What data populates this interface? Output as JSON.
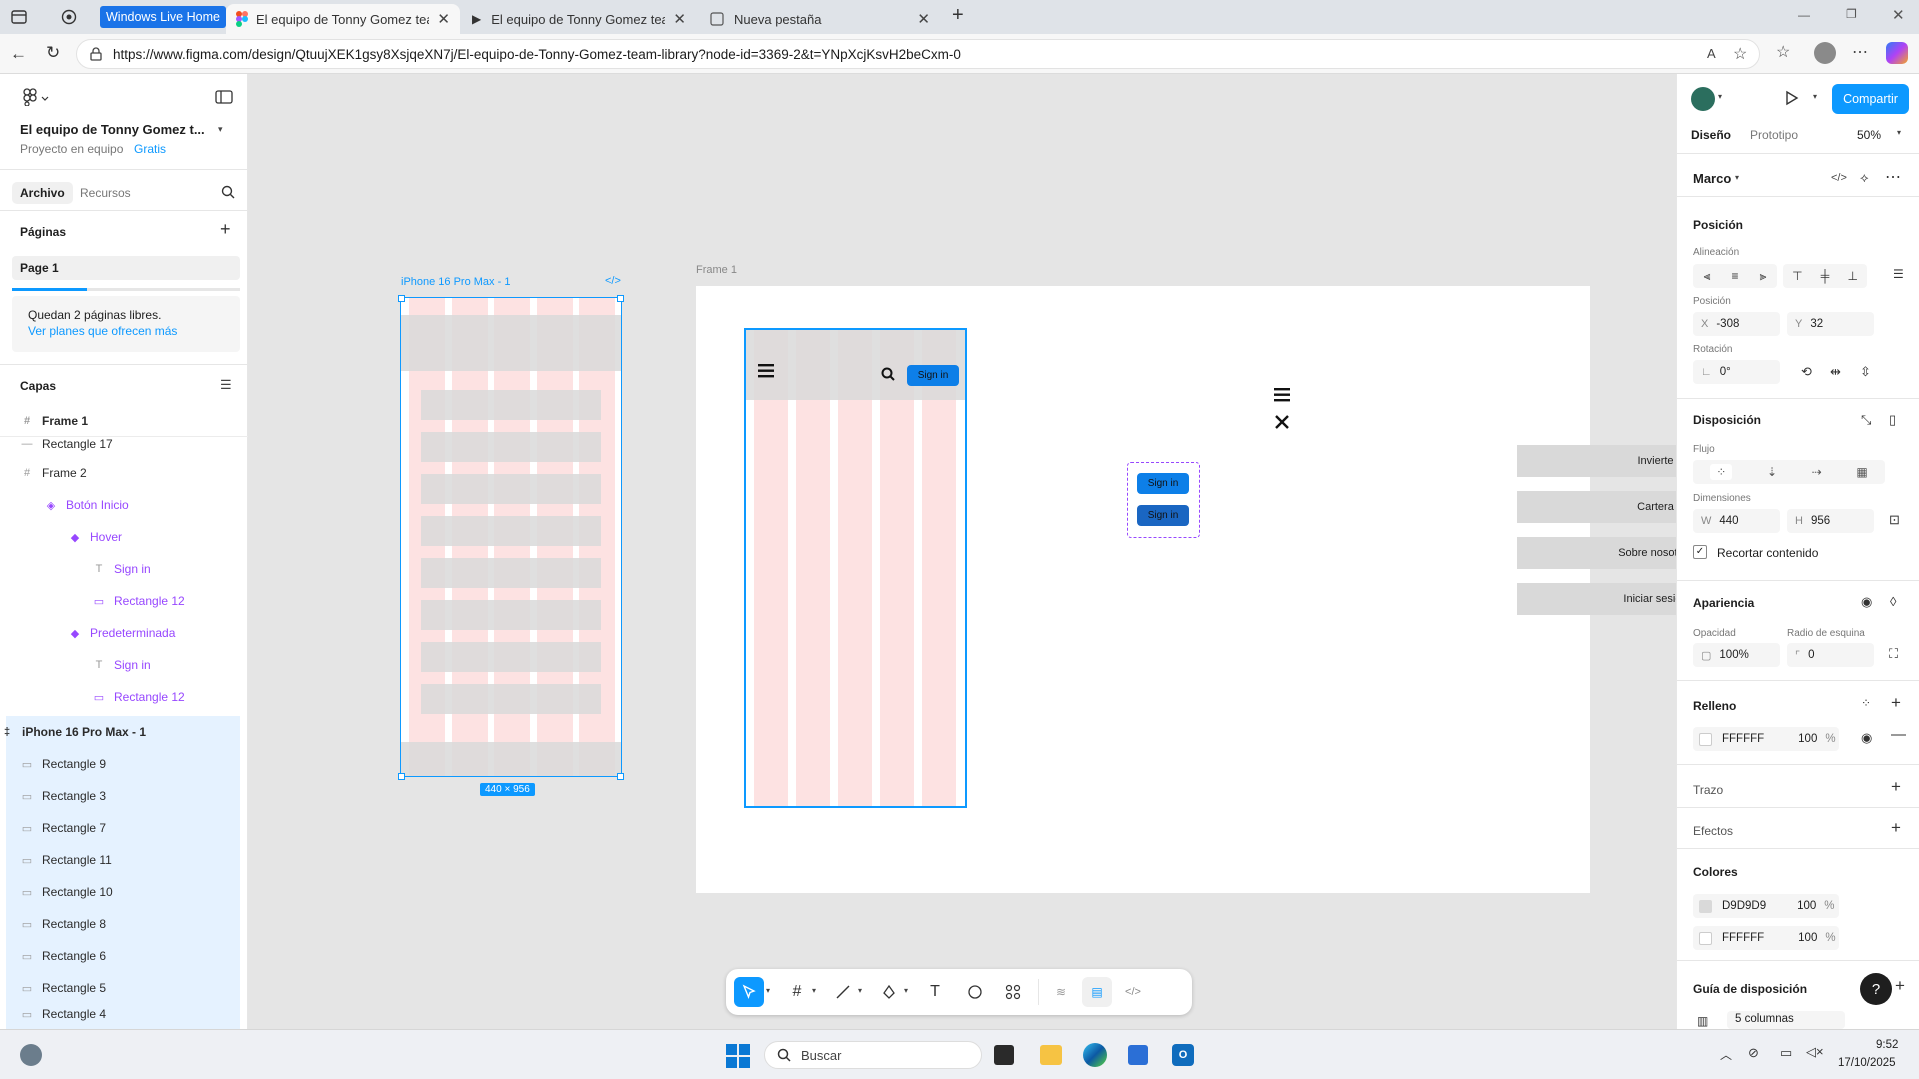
{
  "browser": {
    "tabs": [
      {
        "label": "Windows Live Home"
      },
      {
        "label": "El equipo de Tonny Gomez team l"
      },
      {
        "label": "El equipo de Tonny Gomez team l"
      },
      {
        "label": "Nueva pestaña"
      }
    ],
    "url": "https://www.figma.com/design/QtuujXEK1gsy8XsjqeXN7j/El-equipo-de-Tonny-Gomez-team-library?node-id=3369-2&t=YNpXcjKsvH2beCxm-0"
  },
  "left_panel": {
    "file_name": "El equipo de Tonny Gomez t...",
    "project": "Proyecto en equipo",
    "plan": "Gratis",
    "tabs": [
      "Archivo",
      "Recursos"
    ],
    "pages_title": "Páginas",
    "page": "Page 1",
    "free_pages": "Quedan 2 páginas libres.",
    "plans_link": "Ver planes que ofrecen más",
    "layers_title": "Capas",
    "layers": [
      {
        "name": "Frame 1",
        "icon": "frame-icon"
      },
      {
        "name": "Rectangle 17",
        "icon": "rect-icon"
      },
      {
        "name": "Frame 2",
        "icon": "frame-icon"
      },
      {
        "name": "Botón Inicio",
        "icon": "component-set-icon"
      },
      {
        "name": "Hover",
        "icon": "variant-icon"
      },
      {
        "name": "Sign in",
        "icon": "text-icon"
      },
      {
        "name": "Rectangle 12",
        "icon": "rect-icon"
      },
      {
        "name": "Predeterminada",
        "icon": "variant-icon"
      },
      {
        "name": "Sign in",
        "icon": "text-icon"
      },
      {
        "name": "Rectangle 12",
        "icon": "rect-icon"
      },
      {
        "name": "iPhone 16 Pro Max - 1",
        "icon": "frame-icon"
      },
      {
        "name": "Rectangle 9",
        "icon": "rect-icon"
      },
      {
        "name": "Rectangle 3",
        "icon": "rect-icon"
      },
      {
        "name": "Rectangle 7",
        "icon": "rect-icon"
      },
      {
        "name": "Rectangle 11",
        "icon": "rect-icon"
      },
      {
        "name": "Rectangle 10",
        "icon": "rect-icon"
      },
      {
        "name": "Rectangle 8",
        "icon": "rect-icon"
      },
      {
        "name": "Rectangle 6",
        "icon": "rect-icon"
      },
      {
        "name": "Rectangle 5",
        "icon": "rect-icon"
      },
      {
        "name": "Rectangle 4",
        "icon": "rect-icon"
      }
    ]
  },
  "canvas": {
    "iphone_label": "iPhone 16 Pro Max - 1",
    "size_badge": "440 × 956",
    "frame1_label": "Frame 1",
    "signin": "Sign in",
    "menu_items": [
      "Invierte",
      "Cartera",
      "Sobre nosotros",
      "Iniciar sesión"
    ]
  },
  "right_panel": {
    "share": "Compartir",
    "tabs": [
      "Diseño",
      "Prototipo"
    ],
    "zoom": "50%",
    "frame_type": "Marco",
    "position_title": "Posición",
    "alignment_label": "Alineación",
    "position_label": "Posición",
    "x": "-308",
    "y": "32",
    "rotation_label": "Rotación",
    "rotation": "0°",
    "layout_title": "Disposición",
    "flow_label": "Flujo",
    "dimensions_label": "Dimensiones",
    "w": "440",
    "h": "956",
    "clip": "Recortar contenido",
    "appearance_title": "Apariencia",
    "opacity_label": "Opacidad",
    "radius_label": "Radio de esquina",
    "opacity": "100%",
    "radius": "0",
    "fill_title": "Relleno",
    "fill_hex": "FFFFFF",
    "fill_pct": "100",
    "pct": "%",
    "stroke_title": "Trazo",
    "effects_title": "Efectos",
    "colors_title": "Colores",
    "colors": [
      {
        "hex": "D9D9D9",
        "pct": "100",
        "swatch": "#d9d9d9"
      },
      {
        "hex": "FFFFFF",
        "pct": "100",
        "swatch": "#ffffff"
      }
    ],
    "grid_title": "Guía de disposición",
    "grid_value": "5 columnas"
  },
  "taskbar": {
    "search": "Buscar",
    "time": "9:52",
    "date": "17/10/2025"
  },
  "colors": {
    "accent": "#0d99ff",
    "component": "#9747ff",
    "grid_pink": "#fde2e2",
    "rect_gray": "#d9d9d9"
  }
}
